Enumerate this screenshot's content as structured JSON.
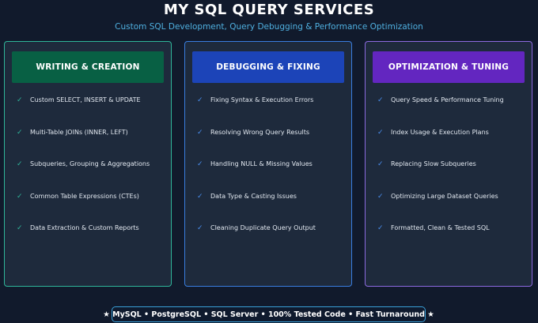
{
  "title": "MY SQL QUERY SERVICES",
  "subtitle": "Custom SQL Development, Query Debugging & Performance Optimization",
  "colors": {
    "background": "#111a2c",
    "card": "#1e2a3c",
    "writing": "#086044",
    "debugging": "#1c44b8",
    "optimization": "#6326c0",
    "accent_teal": "#2fb59a",
    "accent_blue": "#3a7ee0",
    "accent_purple": "#8c6ae0",
    "subtitle": "#4fb0e0"
  },
  "columns": [
    {
      "heading": "WRITING & CREATION",
      "check_icon": "✓",
      "items": [
        "Custom SELECT, INSERT & UPDATE",
        "Multi-Table JOINs (INNER, LEFT)",
        "Subqueries, Grouping & Aggregations",
        "Common Table Expressions (CTEs)",
        "Data Extraction & Custom Reports"
      ]
    },
    {
      "heading": "DEBUGGING & FIXING",
      "check_icon": "✓",
      "items": [
        "Fixing Syntax & Execution Errors",
        "Resolving Wrong Query Results",
        "Handling NULL & Missing Values",
        "Data Type & Casting Issues",
        "Cleaning Duplicate Query Output"
      ]
    },
    {
      "heading": "OPTIMIZATION & TUNING",
      "check_icon": "✓",
      "items": [
        "Query Speed & Performance Tuning",
        "Index Usage & Execution Plans",
        "Replacing Slow Subqueries",
        "Optimizing Large Dataset Queries",
        "Formatted, Clean & Tested SQL"
      ]
    }
  ],
  "footer": "★ MySQL • PostgreSQL • SQL Server  •  100% Tested Code  •  Fast Turnaround ★"
}
